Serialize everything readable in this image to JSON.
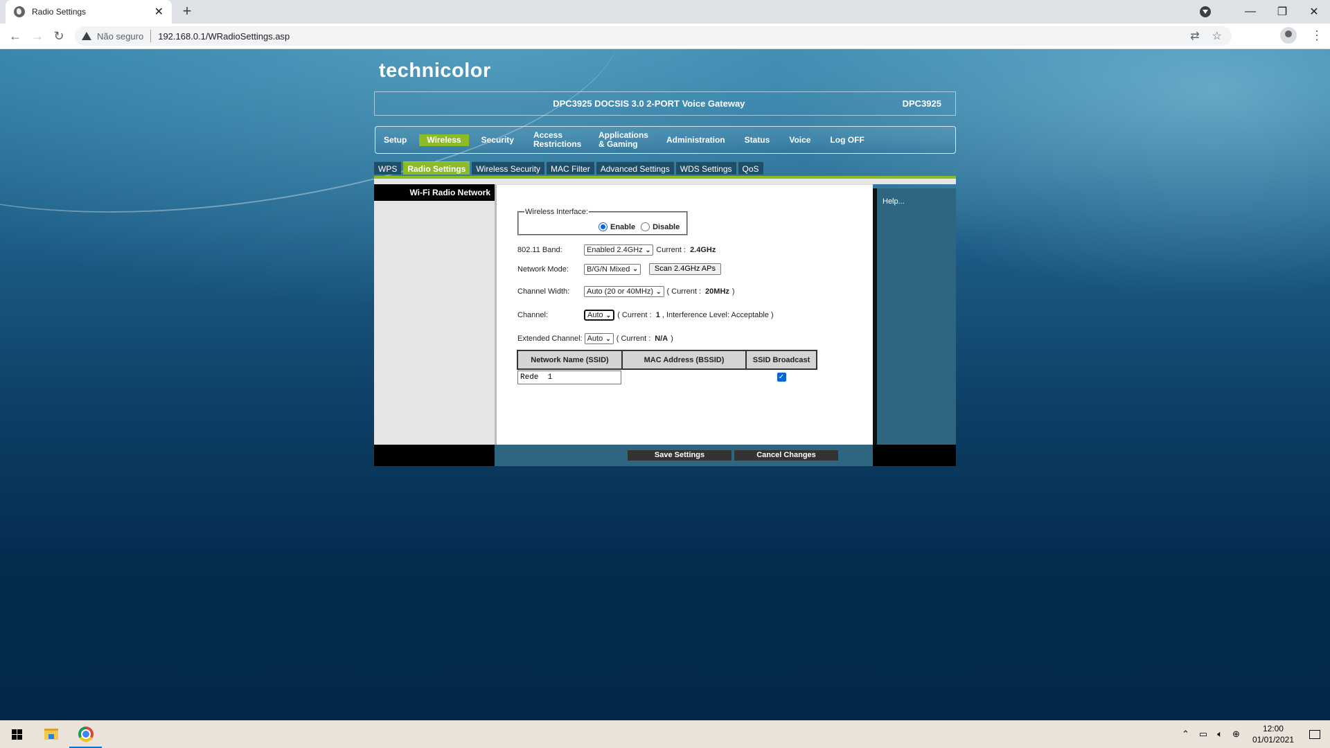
{
  "browser": {
    "tab_title": "Radio Settings",
    "new_tab_label": "+",
    "close_label": "✕",
    "security_label": "Não seguro",
    "url": "192.168.0.1/WRadioSettings.asp",
    "window": {
      "minimize": "—",
      "restore": "❐",
      "close": "✕"
    }
  },
  "router": {
    "brand": "technicolor",
    "product_name": "DPC3925 DOCSIS 3.0 2-PORT Voice Gateway",
    "model": "DPC3925",
    "main_nav": [
      {
        "label": "Setup",
        "active": false
      },
      {
        "label": "Wireless",
        "active": true
      },
      {
        "label": "Security",
        "active": false
      },
      {
        "label": "Access Restrictions",
        "active": false
      },
      {
        "label": "Applications & Gaming",
        "active": false
      },
      {
        "label": "Administration",
        "active": false
      },
      {
        "label": "Status",
        "active": false
      },
      {
        "label": "Voice",
        "active": false
      },
      {
        "label": "Log OFF",
        "active": false
      }
    ],
    "sub_nav": [
      {
        "label": "WPS",
        "active": false
      },
      {
        "label": "Radio Settings",
        "active": true
      },
      {
        "label": "Wireless Security",
        "active": false
      },
      {
        "label": "MAC Filter",
        "active": false
      },
      {
        "label": "Advanced Settings",
        "active": false
      },
      {
        "label": "WDS Settings",
        "active": false
      },
      {
        "label": "QoS",
        "active": false
      }
    ],
    "section_title": "Wi-Fi Radio Network",
    "help_label": "Help...",
    "form": {
      "wireless_interface": {
        "legend": "Wireless Interface:",
        "enable_label": "Enable",
        "disable_label": "Disable",
        "selected": "Enable"
      },
      "band": {
        "label": "802.11 Band:",
        "value": "Enabled 2.4GHz",
        "current_label": "Current :",
        "current_value": "2.4GHz"
      },
      "network_mode": {
        "label": "Network Mode:",
        "value": "B/G/N Mixed",
        "scan_button": "Scan 2.4GHz APs"
      },
      "channel_width": {
        "label": "Channel Width:",
        "value": "Auto (20 or 40MHz)",
        "current_prefix": "( Current :",
        "current_value": "20MHz",
        "suffix": ")"
      },
      "channel": {
        "label": "Channel:",
        "value": "Auto",
        "current_prefix": "( Current :",
        "current_value": "1",
        "interference": ", Interference Level: Acceptable )"
      },
      "extended_channel": {
        "label": "Extended Channel:",
        "value": "Auto",
        "current_prefix": "( Current :",
        "current_value": "N/A",
        "suffix": ")"
      },
      "ssid_table": {
        "headers": [
          "Network Name (SSID)",
          "MAC Address (BSSID)",
          "SSID Broadcast"
        ],
        "rows": [
          {
            "ssid": "Rede  1",
            "bssid": "",
            "broadcast": true
          }
        ]
      }
    },
    "buttons": {
      "save": "Save Settings",
      "cancel": "Cancel Changes"
    }
  },
  "taskbar": {
    "time": "12:00",
    "date": "01/01/2021"
  },
  "colors": {
    "accent_green": "#8cbb28",
    "panel_blue": "#2e6580",
    "radio_blue": "#0a66d6"
  }
}
